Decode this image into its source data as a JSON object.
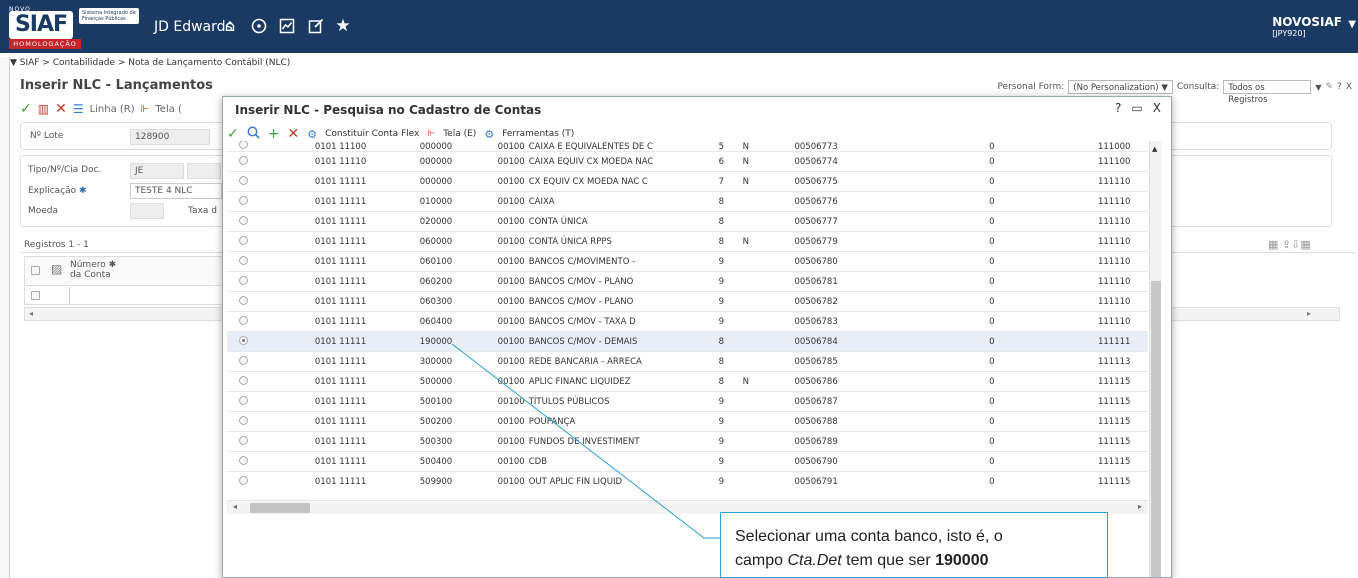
{
  "header": {
    "logo_novo": "NOVO",
    "logo_siaf": "SIAF",
    "logo_subtitle": "Sistema Integrado de Finanças Públicas",
    "logo_badge": "HOMOLOGAÇÃO",
    "app_name": "JD Edwards",
    "icons": [
      "home-icon",
      "recent-icon",
      "chart-icon",
      "edit-icon",
      "favorites-icon"
    ],
    "user_name": "NOVOSIAF",
    "user_env": "[JPY920]"
  },
  "breadcrumb": "▼ SIAF  >  Contabilidade  >  Nota de Lançamento Contábil (NLC)",
  "form": {
    "title": "Inserir NLC - Lançamentos",
    "personal_form_label": "Personal Form:",
    "personal_form_value": "(No Personalization) ▼",
    "consulta_label": "Consulta:",
    "consulta_value": "Todos os Registros",
    "toolbar": {
      "linha": "Linha (R)",
      "tela": "Tela ("
    },
    "lote_label": "Nº Lote",
    "lote_value": "128900",
    "tipo_label": "Tipo/Nº/Cia Doc.",
    "tipo_value": "JE",
    "explicacao_label": "Explicação",
    "explicacao_value": "TESTE 4 NLC",
    "moeda_label": "Moeda",
    "taxa_label": "Taxa d",
    "registros": "Registros 1 - 1",
    "col_numero_conta_1": "Número",
    "col_numero_conta_2": "da Conta"
  },
  "modal": {
    "title": "Inserir NLC - Pesquisa no Cadastro de Contas",
    "help": "?",
    "toolbar": {
      "constituir": "Constituir Conta Flex",
      "tela": "Tela (E)",
      "ferramentas": "Ferramentas (T)"
    },
    "rows": [
      {
        "bu": "0101 11100",
        "obj": "000000",
        "cia": "00100",
        "desc": "CAIXA E EQUIVALENTES DE C",
        "lvl": "5",
        "pe": "N",
        "id": "00506773",
        "z": "0",
        "sub": "111000",
        "sel": false,
        "partial": true
      },
      {
        "bu": "0101 11110",
        "obj": "000000",
        "cia": "00100",
        "desc": "CAIXA EQUIV CX MOEDA NAC",
        "lvl": "6",
        "pe": "N",
        "id": "00506774",
        "z": "0",
        "sub": "111100",
        "sel": false
      },
      {
        "bu": "0101 11111",
        "obj": "000000",
        "cia": "00100",
        "desc": "CX EQUIV CX MOEDA NAC C",
        "lvl": "7",
        "pe": "N",
        "id": "00506775",
        "z": "0",
        "sub": "111110",
        "sel": false
      },
      {
        "bu": "0101 11111",
        "obj": "010000",
        "cia": "00100",
        "desc": "CAIXA",
        "lvl": "8",
        "pe": "",
        "id": "00506776",
        "z": "0",
        "sub": "111110",
        "sel": false
      },
      {
        "bu": "0101 11111",
        "obj": "020000",
        "cia": "00100",
        "desc": "CONTA ÚNICA",
        "lvl": "8",
        "pe": "",
        "id": "00506777",
        "z": "0",
        "sub": "111110",
        "sel": false
      },
      {
        "bu": "0101 11111",
        "obj": "060000",
        "cia": "00100",
        "desc": "CONTA ÚNICA RPPS",
        "lvl": "8",
        "pe": "N",
        "id": "00506779",
        "z": "0",
        "sub": "111110",
        "sel": false
      },
      {
        "bu": "0101 11111",
        "obj": "060100",
        "cia": "00100",
        "desc": "BANCOS C/MOVIMENTO -",
        "lvl": "9",
        "pe": "",
        "id": "00506780",
        "z": "0",
        "sub": "111110",
        "sel": false
      },
      {
        "bu": "0101 11111",
        "obj": "060200",
        "cia": "00100",
        "desc": "BANCOS C/MOV - PLANO",
        "lvl": "9",
        "pe": "",
        "id": "00506781",
        "z": "0",
        "sub": "111110",
        "sel": false
      },
      {
        "bu": "0101 11111",
        "obj": "060300",
        "cia": "00100",
        "desc": "BANCOS C/MOV - PLANO",
        "lvl": "9",
        "pe": "",
        "id": "00506782",
        "z": "0",
        "sub": "111110",
        "sel": false
      },
      {
        "bu": "0101 11111",
        "obj": "060400",
        "cia": "00100",
        "desc": "BANCOS C/MOV - TAXA D",
        "lvl": "9",
        "pe": "",
        "id": "00506783",
        "z": "0",
        "sub": "111110",
        "sel": false
      },
      {
        "bu": "0101 11111",
        "obj": "190000",
        "cia": "00100",
        "desc": "BANCOS C/MOV - DEMAIS",
        "lvl": "8",
        "pe": "",
        "id": "00506784",
        "z": "0",
        "sub": "111111",
        "sel": true
      },
      {
        "bu": "0101 11111",
        "obj": "300000",
        "cia": "00100",
        "desc": "REDE BANCARIA - ARRECA",
        "lvl": "8",
        "pe": "",
        "id": "00506785",
        "z": "0",
        "sub": "111113",
        "sel": false
      },
      {
        "bu": "0101 11111",
        "obj": "500000",
        "cia": "00100",
        "desc": "APLIC FINANC LIQUIDEZ",
        "lvl": "8",
        "pe": "N",
        "id": "00506786",
        "z": "0",
        "sub": "111115",
        "sel": false
      },
      {
        "bu": "0101 11111",
        "obj": "500100",
        "cia": "00100",
        "desc": "TÍTULOS PÚBLICOS",
        "lvl": "9",
        "pe": "",
        "id": "00506787",
        "z": "0",
        "sub": "111115",
        "sel": false
      },
      {
        "bu": "0101 11111",
        "obj": "500200",
        "cia": "00100",
        "desc": "POUPANÇA",
        "lvl": "9",
        "pe": "",
        "id": "00506788",
        "z": "0",
        "sub": "111115",
        "sel": false
      },
      {
        "bu": "0101 11111",
        "obj": "500300",
        "cia": "00100",
        "desc": "FUNDOS DE INVESTIMENT",
        "lvl": "9",
        "pe": "",
        "id": "00506789",
        "z": "0",
        "sub": "111115",
        "sel": false
      },
      {
        "bu": "0101 11111",
        "obj": "500400",
        "cia": "00100",
        "desc": "CDB",
        "lvl": "9",
        "pe": "",
        "id": "00506790",
        "z": "0",
        "sub": "111115",
        "sel": false
      },
      {
        "bu": "0101 11111",
        "obj": "509900",
        "cia": "00100",
        "desc": "OUT APLIC FIN LIQUID",
        "lvl": "9",
        "pe": "",
        "id": "00506791",
        "z": "0",
        "sub": "111115",
        "sel": false
      }
    ]
  },
  "callout": {
    "line1": "Selecionar uma conta banco, isto é, o",
    "line2_pre": "campo ",
    "line2_em": "Cta.Det",
    "line2_mid": " tem que ser ",
    "line2_bold": "190000"
  },
  "colors": {
    "header_bg": "#1b3a63",
    "accent_red": "#c8242b",
    "callout_border": "#2a9fd6"
  }
}
